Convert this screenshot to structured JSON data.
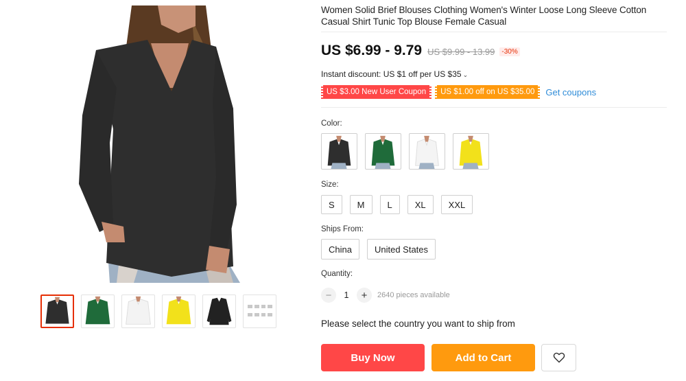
{
  "product": {
    "title": "Women Solid Brief Blouses Clothing Women's Winter Loose Long Sleeve Cotton Casual Shirt Tunic Top Blouse Female Casual"
  },
  "price": {
    "current": "US $6.99 - 9.79",
    "original": "US $9.99 - 13.99",
    "discount": "-30%"
  },
  "instant_discount": {
    "text": "Instant discount: US $1 off per US $35",
    "chevron": "⌄"
  },
  "coupons": {
    "new_user": "US $3.00 New User Coupon",
    "store": "US $1.00 off on US $35.00",
    "get_link": "Get coupons"
  },
  "color": {
    "label": "Color:",
    "options": [
      "black",
      "green",
      "white",
      "yellow"
    ]
  },
  "size": {
    "label": "Size:",
    "options": [
      "S",
      "M",
      "L",
      "XL",
      "XXL"
    ]
  },
  "ships_from": {
    "label": "Ships From:",
    "options": [
      "China",
      "United States"
    ]
  },
  "quantity": {
    "label": "Quantity:",
    "minus": "−",
    "plus": "+",
    "value": "1",
    "available": "2640 pieces available"
  },
  "ship_note": "Please select the country you want to ship from",
  "buttons": {
    "buy_now": "Buy Now",
    "add_to_cart": "Add to Cart",
    "wishlist_icon": "heart-icon"
  },
  "colors": {
    "accent_red": "#ff4747",
    "accent_orange": "#ff9a0e",
    "link_blue": "#2f8cd8",
    "thumb_active_border": "#e62e04"
  }
}
